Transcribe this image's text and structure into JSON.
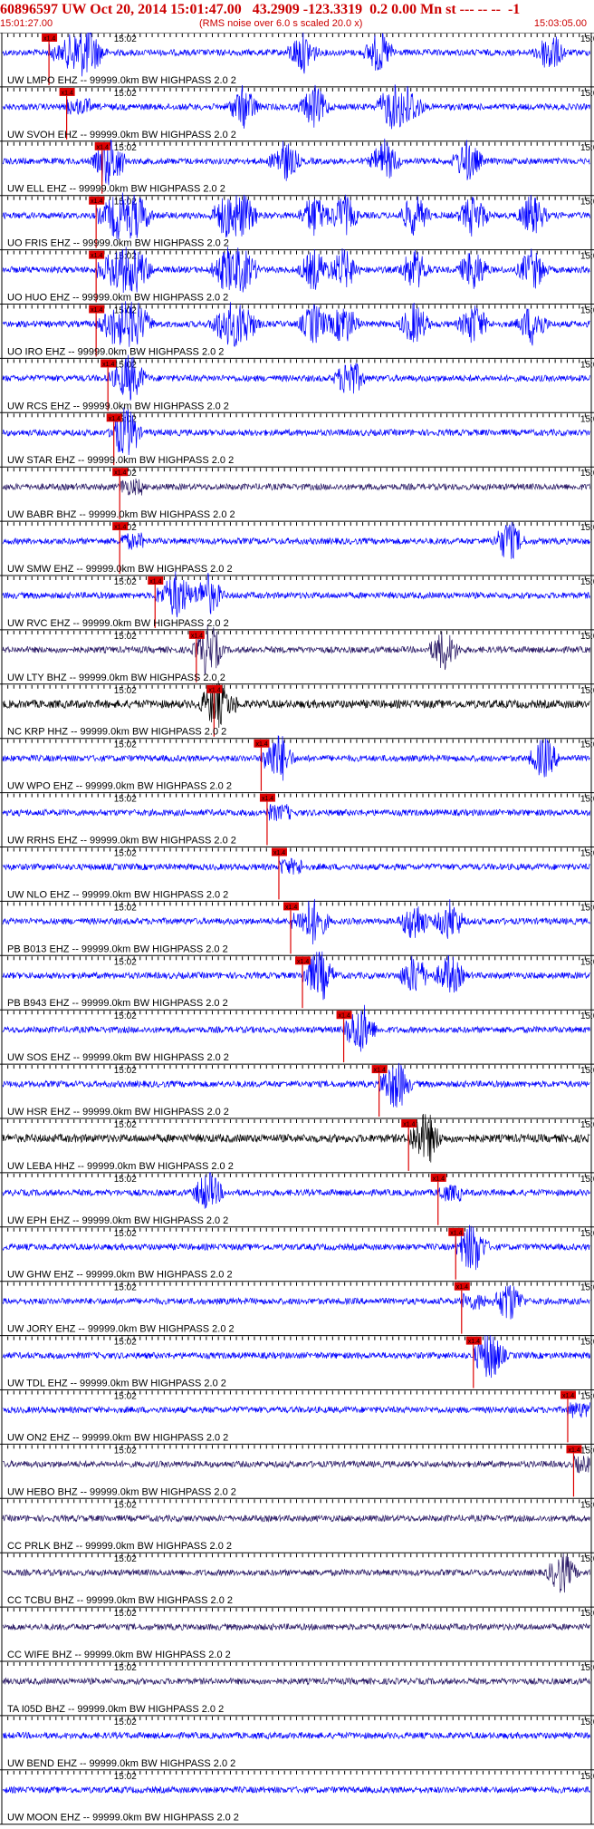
{
  "header": {
    "title": "60896597 UW Oct 20, 2014 15:01:47.00   43.2909 -123.3319  0.2 0.00 Mn st --- -- --  -1",
    "start_time": "15:01:27.00",
    "rms_note": "(RMS noise over 6.0 s scaled 20.0 x)",
    "end_time": "15:03:05.00",
    "tick_mid": "15:02",
    "tick_end": "15:03"
  },
  "chart_data": {
    "type": "seismogram",
    "title": "60896597 UW Oct 20, 2014 15:01:47.00",
    "time_range": [
      "15:01:27.00",
      "15:03:05.00"
    ],
    "x_ticks": [
      "15:02",
      "15:03"
    ],
    "pick_label": "x1.4",
    "colors": {
      "blue": "#0000ff",
      "purple": "#2a1a66",
      "black": "#000000",
      "pick": "#dd0000"
    },
    "stations": [
      {
        "label": "UW LMPO EHZ -- 99999.0km BW  HIGHPASS  2.0  2",
        "color": "blue",
        "pick": 0.08,
        "bursts": [
          0.13,
          0.15,
          0.51,
          0.64,
          0.93
        ]
      },
      {
        "label": "UW SVOH EHZ -- 99999.0km BW  HIGHPASS  2.0  2",
        "color": "blue",
        "pick": 0.11,
        "bursts": [
          0.41,
          0.53,
          0.66,
          0.69
        ]
      },
      {
        "label": "UW ELL EHZ -- 99999.0km BW  HIGHPASS  2.0  2",
        "color": "blue",
        "pick": 0.17,
        "bursts": [
          0.18,
          0.48,
          0.65,
          0.79
        ]
      },
      {
        "label": "UO FRIS EHZ -- 99999.0km BW  HIGHPASS  2.0  2",
        "color": "blue",
        "pick": 0.16,
        "bursts": [
          0.2,
          0.23,
          0.38,
          0.41,
          0.53,
          0.58,
          0.7,
          0.8,
          0.9
        ]
      },
      {
        "label": "UO HUO EHZ -- 99999.0km BW  HIGHPASS  2.0  2",
        "color": "blue",
        "pick": 0.16,
        "bursts": [
          0.2,
          0.23,
          0.38,
          0.41,
          0.53,
          0.58,
          0.7,
          0.8,
          0.9
        ]
      },
      {
        "label": "UO IRO EHZ -- 99999.0km BW  HIGHPASS  2.0  2",
        "color": "blue",
        "pick": 0.16,
        "bursts": [
          0.2,
          0.23,
          0.38,
          0.41,
          0.53,
          0.58,
          0.7,
          0.8,
          0.9
        ]
      },
      {
        "label": "UW RCS EHZ -- 99999.0km BW  HIGHPASS  2.0  2",
        "color": "blue",
        "pick": 0.18,
        "bursts": [
          0.22,
          0.59
        ]
      },
      {
        "label": "UW STAR EHZ -- 99999.0km BW  HIGHPASS  2.0  2",
        "color": "blue",
        "pick": 0.19,
        "bursts": [
          0.21
        ]
      },
      {
        "label": "UW BABR BHZ -- 99999.0km BW  HIGHPASS  2.0  2",
        "color": "purple",
        "pick": 0.2,
        "bursts": []
      },
      {
        "label": "UW SMW EHZ -- 99999.0km BW  HIGHPASS  2.0  2",
        "color": "blue",
        "pick": 0.2,
        "bursts": [
          0.86
        ]
      },
      {
        "label": "UW RVC EHZ -- 99999.0km BW  HIGHPASS  2.0  2",
        "color": "blue",
        "pick": 0.26,
        "bursts": [
          0.3,
          0.35
        ]
      },
      {
        "label": "UW LTY BHZ -- 99999.0km BW  HIGHPASS  2.0  2",
        "color": "purple",
        "pick": 0.33,
        "bursts": [
          0.35,
          0.75
        ]
      },
      {
        "label": "NC KRP HHZ -- 99999.0km BW  HIGHPASS  2.0  2",
        "color": "black",
        "pick": 0.36,
        "bursts": [
          0.36
        ]
      },
      {
        "label": "UW WPO EHZ -- 99999.0km BW  HIGHPASS  2.0  2",
        "color": "blue",
        "pick": 0.44,
        "bursts": [
          0.47,
          0.92
        ]
      },
      {
        "label": "UW RRHS EHZ -- 99999.0km BW  HIGHPASS  2.0  2",
        "color": "blue",
        "pick": 0.45,
        "bursts": []
      },
      {
        "label": "UW NLO EHZ -- 99999.0km BW  HIGHPASS  2.0  2",
        "color": "blue",
        "pick": 0.47,
        "bursts": []
      },
      {
        "label": "PB B013 EHZ -- 99999.0km BW  HIGHPASS  2.0  2",
        "color": "blue",
        "pick": 0.49,
        "bursts": [
          0.53,
          0.7,
          0.76
        ]
      },
      {
        "label": "PB B943 EHZ -- 99999.0km BW  HIGHPASS  2.0  2",
        "color": "blue",
        "pick": 0.51,
        "bursts": [
          0.54,
          0.7,
          0.76
        ]
      },
      {
        "label": "UW SOS EHZ -- 99999.0km BW  HIGHPASS  2.0  2",
        "color": "blue",
        "pick": 0.58,
        "bursts": [
          0.61
        ]
      },
      {
        "label": "UW HSR EHZ -- 99999.0km BW  HIGHPASS  2.0  2",
        "color": "blue",
        "pick": 0.64,
        "bursts": [
          0.67
        ]
      },
      {
        "label": "UW LEBA HHZ -- 99999.0km BW  HIGHPASS  2.0  2",
        "color": "black",
        "pick": 0.69,
        "bursts": [
          0.72
        ]
      },
      {
        "label": "UW EPH EHZ -- 99999.0km BW  HIGHPASS  2.0  2",
        "color": "blue",
        "pick": 0.74,
        "bursts": [
          0.35
        ]
      },
      {
        "label": "UW GHW EHZ -- 99999.0km BW  HIGHPASS  2.0  2",
        "color": "blue",
        "pick": 0.77,
        "bursts": [
          0.8
        ]
      },
      {
        "label": "UW JORY EHZ -- 99999.0km BW  HIGHPASS  2.0  2",
        "color": "blue",
        "pick": 0.78,
        "bursts": [
          0.86
        ]
      },
      {
        "label": "UW TDL EHZ -- 99999.0km BW  HIGHPASS  2.0  2",
        "color": "blue",
        "pick": 0.8,
        "bursts": [
          0.83
        ]
      },
      {
        "label": "UW ON2 EHZ -- 99999.0km BW  HIGHPASS  2.0  2",
        "color": "blue",
        "pick": 0.96,
        "bursts": []
      },
      {
        "label": "UW HEBO BHZ -- 99999.0km BW  HIGHPASS  2.0  2",
        "color": "purple",
        "pick": 0.97,
        "bursts": []
      },
      {
        "label": "CC PRLK BHZ -- 99999.0km BW  HIGHPASS  2.0  2",
        "color": "purple",
        "pick": null,
        "bursts": []
      },
      {
        "label": "CC TCBU BHZ -- 99999.0km BW  HIGHPASS  2.0  2",
        "color": "purple",
        "pick": null,
        "bursts": [
          0.95
        ]
      },
      {
        "label": "CC WIFE BHZ -- 99999.0km BW  HIGHPASS  2.0  2",
        "color": "purple",
        "pick": null,
        "bursts": []
      },
      {
        "label": "TA I05D BHZ -- 99999.0km BW  HIGHPASS  2.0  2",
        "color": "purple",
        "pick": null,
        "bursts": []
      },
      {
        "label": "UW BEND EHZ -- 99999.0km BW  HIGHPASS  2.0  2",
        "color": "blue",
        "pick": null,
        "bursts": []
      },
      {
        "label": "UW MOON EHZ -- 99999.0km BW  HIGHPASS  2.0  2",
        "color": "blue",
        "pick": null,
        "bursts": []
      }
    ]
  }
}
